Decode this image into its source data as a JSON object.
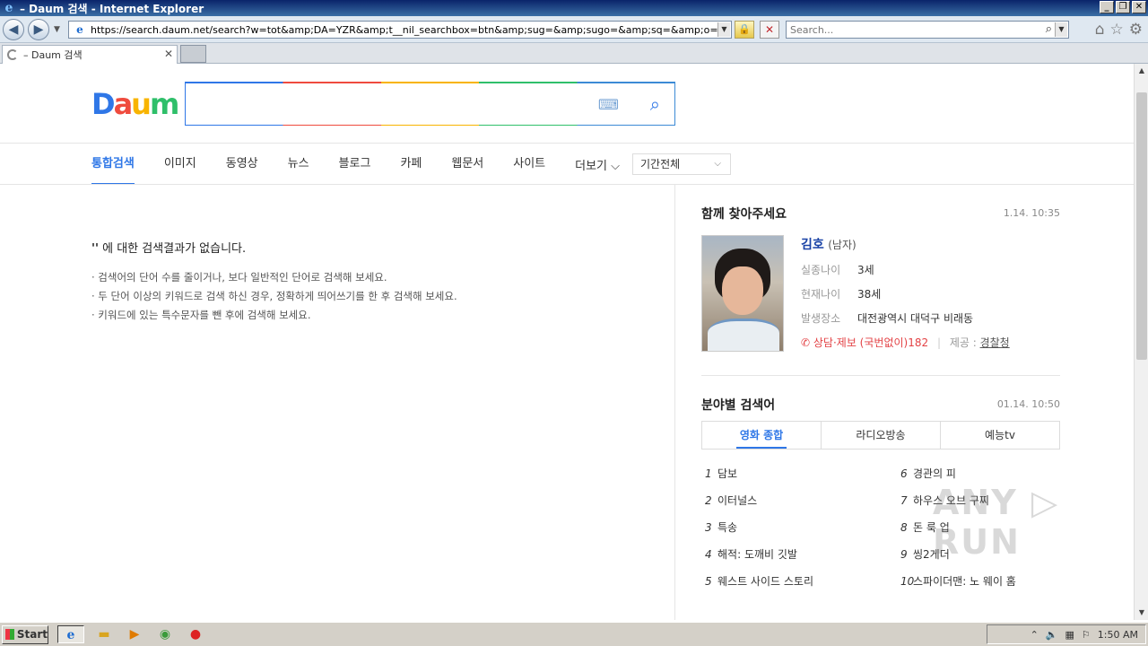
{
  "window": {
    "title": "– Daum 검색 - Internet Explorer",
    "controls": [
      "_",
      "❐",
      "✕"
    ]
  },
  "nav": {
    "url": "https://search.daum.net/search?w=tot&amp;DA=YZR&amp;t__nil_searchbox=btn&amp;sug=&amp;sugo=&amp;sq=&amp;o=&amp;q=????&am",
    "search_placeholder": "Search..."
  },
  "tab": {
    "label": "– Daum 검색"
  },
  "daum": {
    "logo": [
      "D",
      "a",
      "u",
      "m"
    ],
    "gnb": {
      "items": [
        "통합검색",
        "이미지",
        "동영상",
        "뉴스",
        "블로그",
        "카페",
        "웹문서",
        "사이트"
      ],
      "more": "더보기 ⌵",
      "period": "기간전체"
    }
  },
  "noresult": {
    "query": "''",
    "headline_rest": " 에 대한 검색결과가 없습니다.",
    "tips": [
      "· 검색어의 단어 수를 줄이거나, 보다 일반적인 단어로 검색해 보세요.",
      "· 두 단어 이상의 키워드로 검색 하신 경우, 정확하게 띄어쓰기를 한 후 검색해 보세요.",
      "· 키워드에 있는 특수문자를 뺀 후에 검색해 보세요."
    ]
  },
  "missing": {
    "title": "함께 찾아주세요",
    "time": "1.14. 10:35",
    "name": "김호",
    "gender": "(남자)",
    "rows": [
      {
        "label": "실종나이",
        "value": "3세"
      },
      {
        "label": "현재나이",
        "value": "38세"
      },
      {
        "label": "발생장소",
        "value": "대전광역시 대덕구 비래동"
      }
    ],
    "tel": "상담·제보 (국번없이)182",
    "provider_label": "제공 : ",
    "provider": "경찰청"
  },
  "category": {
    "title": "분야별 검색어",
    "time": "01.14. 10:50",
    "tabs": [
      "영화 종합",
      "라디오방송",
      "예능tv"
    ],
    "left": [
      {
        "n": "1",
        "t": "담보"
      },
      {
        "n": "2",
        "t": "이터널스"
      },
      {
        "n": "3",
        "t": "특송"
      },
      {
        "n": "4",
        "t": "해적: 도깨비 깃발"
      },
      {
        "n": "5",
        "t": "웨스트 사이드 스토리"
      }
    ],
    "right": [
      {
        "n": "6",
        "t": "경관의 피"
      },
      {
        "n": "7",
        "t": "하우스 오브 구찌"
      },
      {
        "n": "8",
        "t": "돈 룩 업"
      },
      {
        "n": "9",
        "t": "씽2게더"
      },
      {
        "n": "10",
        "t": "스파이더맨: 노 웨이 홈"
      }
    ]
  },
  "watermark": "ANY ▷ RUN",
  "taskbar": {
    "start": "Start",
    "clock": "1:50 AM"
  }
}
